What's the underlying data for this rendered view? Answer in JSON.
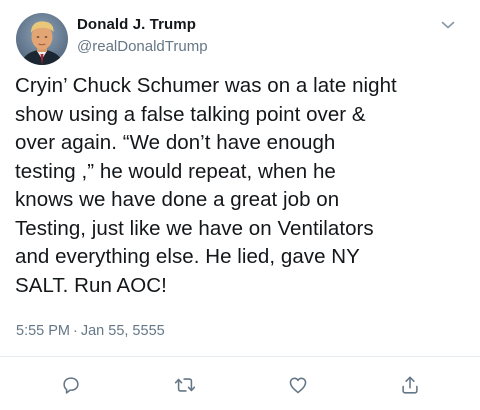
{
  "author": {
    "display_name": "Donald J. Trump",
    "handle": "@realDonaldTrump"
  },
  "tweet": {
    "text": "Cryin’ Chuck Schumer was on a late night\nshow using a false talking point over &\nover again. “We don’t have enough\ntesting ,” he would repeat, when he\nknows we have done a great job on\nTesting, just like we have on Ventilators\nand everything else. He lied, gave NY\nSALT. Run AOC!",
    "time": "5:55 PM",
    "separator": "·",
    "date": "Jan 55, 5555"
  },
  "icons": {
    "caret": "chevron-down-icon",
    "reply": "reply-icon",
    "retweet": "retweet-icon",
    "like": "heart-icon",
    "share": "share-icon"
  },
  "colors": {
    "text": "#14171a",
    "secondary": "#657786",
    "divider": "#e6ecf0"
  }
}
